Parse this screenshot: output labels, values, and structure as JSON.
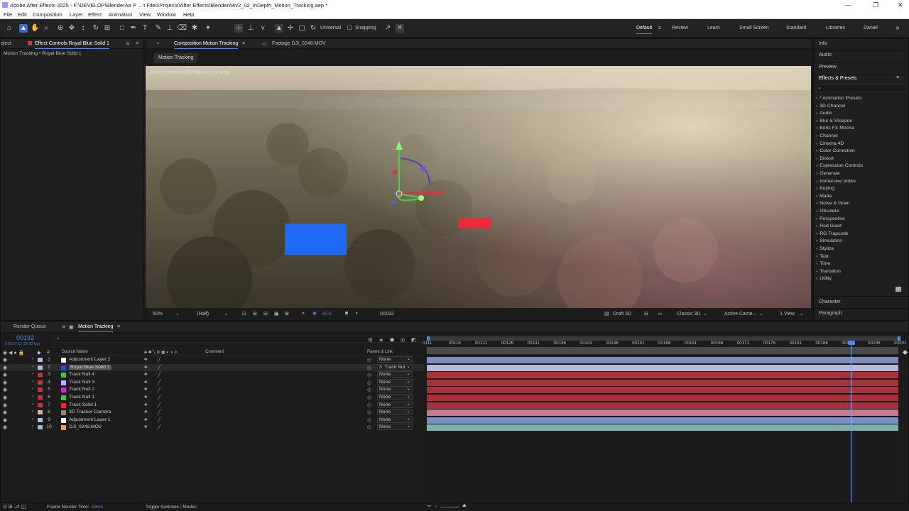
{
  "titlebar": {
    "title": "Adobe After Effects 2025 - F:\\DEVELOP\\BlenderAe P ... t Files\\Projects\\After Effects\\BlenderAev2_02_InDepth_Motion_Tracking.aep *",
    "min": "—",
    "max": "❐",
    "close": "✕"
  },
  "menu": [
    "File",
    "Edit",
    "Composition",
    "Layer",
    "Effect",
    "Animation",
    "View",
    "Window",
    "Help"
  ],
  "toolbar": {
    "universal": "Universal",
    "snapping": "Snapping"
  },
  "workspaces": [
    "Default",
    "Review",
    "Learn",
    "Small Screen",
    "Standard",
    "Libraries",
    "Daniel"
  ],
  "left_panel": {
    "tab_project": "oject",
    "tab_effect": "Effect Controls Royal Blue Solid 1",
    "subtitle": "Motion Tracking • Royal Blue Solid 1"
  },
  "comp_panel": {
    "tab_comp": "Composition Motion Tracking",
    "tab_footage": "Footage DJI_0248.MOV",
    "chip": "Motion Tracking",
    "camera_label": "Active Camera (3D Tracker Camera)"
  },
  "viewer_bar": {
    "zoom": "50%",
    "resolution": "(Half)",
    "exposure": "+0.0",
    "timecode": "00192",
    "renderer": "Draft 3D",
    "mode": "Classic 3D",
    "camera": "Active Came...",
    "views": "1 View"
  },
  "right_panel": {
    "info": "Info",
    "audio": "Audio",
    "preview": "Preview",
    "effects_title": "Effects & Presets",
    "search_placeholder": "",
    "character": "Character",
    "paragraph": "Paragraph",
    "effects": [
      "* Animation Presets",
      "3D Channel",
      "Audio",
      "Blur & Sharpen",
      "Boris FX Mocha",
      "Channel",
      "Cinema 4D",
      "Color Correction",
      "Distort",
      "Expression Controls",
      "Generate",
      "Immersive Video",
      "Keying",
      "Matte",
      "Noise & Grain",
      "Obsolete",
      "Perspective",
      "Red Giant",
      "RG Trapcode",
      "Simulation",
      "Stylize",
      "Text",
      "Time",
      "Transition",
      "Utility"
    ]
  },
  "timeline": {
    "tab_render": "Render Queue",
    "tab_comp": "Motion Tracking",
    "timecode": "00192",
    "sub_timecode": "0:00:07:12 (25.00 fps)",
    "col_hash": "#",
    "col_source": "Source Name",
    "col_comment": "Comment",
    "col_parent": "Parent & Link",
    "layers": [
      {
        "num": "1",
        "name": "Adjustment Layer 2",
        "parent": "None",
        "label": "#b8b8d8",
        "sq": "#ffffff"
      },
      {
        "num": "2",
        "name": "Royal Blue Solid 1",
        "parent": "3. Track Nul",
        "label": "#b8b8d8",
        "sq": "#1f4fe0"
      },
      {
        "num": "3",
        "name": "Track Null 4",
        "parent": "None",
        "label": "#c8323c",
        "sq": "#3cc83c"
      },
      {
        "num": "4",
        "name": "Track Null 3",
        "parent": "None",
        "label": "#c8323c",
        "sq": "#b8b8ff"
      },
      {
        "num": "5",
        "name": "Track Null 2",
        "parent": "None",
        "label": "#c8323c",
        "sq": "#c832c8"
      },
      {
        "num": "6",
        "name": "Track Null 1",
        "parent": "None",
        "label": "#c8323c",
        "sq": "#3cc83c"
      },
      {
        "num": "7",
        "name": "Track Solid 1",
        "parent": "None",
        "label": "#c8323c",
        "sq": "#e03030"
      },
      {
        "num": "8",
        "name": "3D Tracker Camera",
        "parent": "None",
        "label": "#e8a0b8",
        "sq": "#888888"
      },
      {
        "num": "9",
        "name": "Adjustment Layer 1",
        "parent": "None",
        "label": "#b8b8d8",
        "sq": "#ffffff"
      },
      {
        "num": "10",
        "name": "DJI_0248.MOV",
        "parent": "None",
        "label": "#8fc0b8",
        "sq": "#e0a040"
      }
    ],
    "ruler": [
      "0111",
      "00116",
      "00121",
      "00126",
      "00131",
      "00136",
      "00141",
      "00146",
      "00151",
      "00156",
      "00161",
      "00166",
      "00171",
      "00176",
      "00181",
      "00186",
      "00191",
      "00196",
      "00201"
    ],
    "playhead_frame": 192,
    "range_start": 111,
    "range_end": 201,
    "bar_colors": [
      "#7d8fbf",
      "#b8b8d8",
      "#a8323c",
      "#a8323c",
      "#a8323c",
      "#a8323c",
      "#a8323c",
      "#c87a90",
      "#7d8fbf",
      "#7fb0a8"
    ],
    "frame_render_label": "Frame Render Time:",
    "frame_render_value": "23ms",
    "toggle": "Toggle Switches / Modes"
  }
}
